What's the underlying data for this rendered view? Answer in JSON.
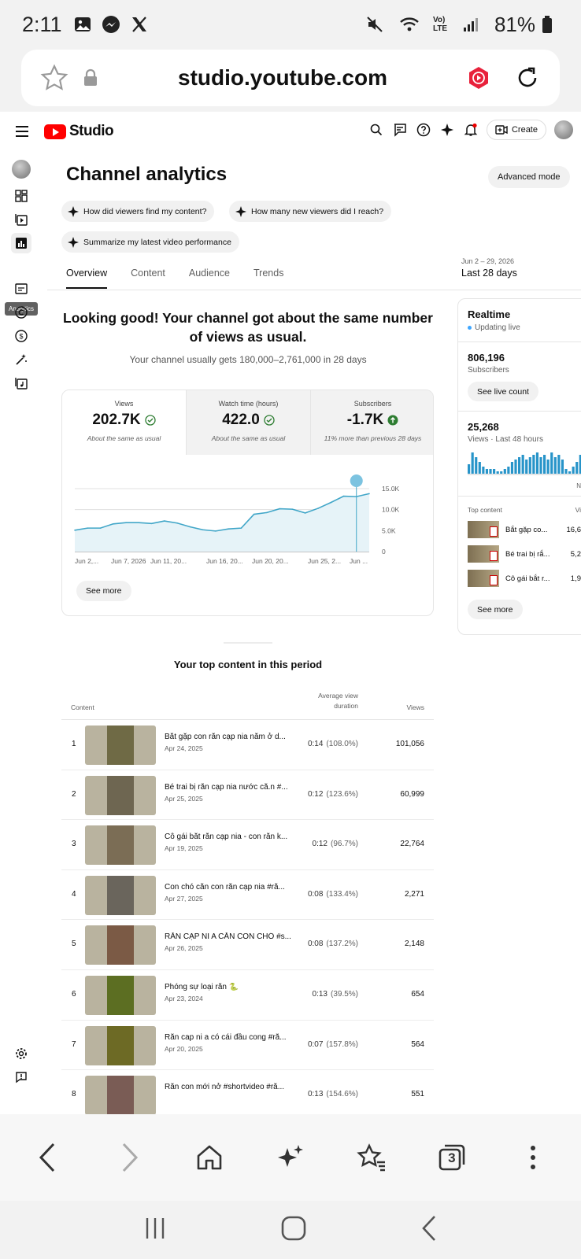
{
  "status_bar": {
    "time": "2:11",
    "battery": "81%",
    "network": "Vo) LTE"
  },
  "browser": {
    "url": "studio.youtube.com"
  },
  "header": {
    "logo_text": "Studio",
    "create_label": "Create"
  },
  "sidebar": {
    "tooltip": "Analytics"
  },
  "page": {
    "title": "Channel analytics",
    "advanced_mode_label": "Advanced mode"
  },
  "suggestions": [
    {
      "label": "How did viewers find my content?"
    },
    {
      "label": "How many new viewers did I reach?"
    },
    {
      "label": "Summarize my latest video performance"
    }
  ],
  "tabs": [
    {
      "label": "Overview",
      "active": true
    },
    {
      "label": "Content"
    },
    {
      "label": "Audience"
    },
    {
      "label": "Trends"
    }
  ],
  "date_range": {
    "dates": "Jun 2 – 29, 2026",
    "label": "Last 28 days"
  },
  "summary": {
    "headline": "Looking good! Your channel got about the same number of views as usual.",
    "subline": "Your channel usually gets 180,000–2,761,000 in 28 days"
  },
  "metrics": [
    {
      "label": "Views",
      "value": "202.7K",
      "note": "About the same as usual"
    },
    {
      "label": "Watch time (hours)",
      "value": "422.0",
      "note": "About the same as usual"
    },
    {
      "label": "Subscribers",
      "value": "-1.7K",
      "note": "11% more than previous 28 days"
    }
  ],
  "overview_see_more": "See more",
  "chart_data": {
    "type": "area",
    "series": [
      {
        "values": [
          5100,
          5600,
          5600,
          6600,
          6900,
          6900,
          6700,
          7300,
          6800,
          5900,
          5200,
          4900,
          5400,
          5600,
          8900,
          9300,
          10200,
          10100,
          9200,
          10300,
          11700,
          13200,
          13100,
          13800
        ]
      }
    ],
    "x_tick_labels": [
      "Jun 2,...",
      "Jun 7, 2026",
      "Jun 11, 20...",
      "Jun 16, 20...",
      "Jun 20, 20...",
      "Jun 25, 2...",
      "Jun ..."
    ],
    "y_tick_labels": [
      "15.0K",
      "10.0K",
      "5.0K",
      "0"
    ],
    "ylim": [
      0,
      15000
    ],
    "grid": true,
    "line_color": "#41a6c8",
    "fill_color": "#e6f3f8"
  },
  "realtime": {
    "title": "Realtime",
    "status": "Updating live",
    "subscribers_value": "806,196",
    "subscribers_label": "Subscribers",
    "live_count_label": "See live count",
    "views_value": "25,268",
    "views_label": "Views · Last 48 hours",
    "bars": [
      0.4,
      0.9,
      0.7,
      0.5,
      0.3,
      0.2,
      0.2,
      0.2,
      0.1,
      0.1,
      0.2,
      0.3,
      0.5,
      0.6,
      0.7,
      0.8,
      0.6,
      0.7,
      0.8,
      0.9,
      0.7,
      0.8,
      0.6,
      0.9,
      0.7,
      0.8,
      0.6,
      0.2,
      0.1,
      0.3,
      0.5,
      0.8,
      0.6,
      0.9,
      1.0
    ],
    "bars_color": "#2794c9",
    "axis_end_label": "N",
    "top_content_label": "Top content",
    "top_content_views_label": "Vi",
    "top_content": [
      {
        "title": "Bắt gặp co...",
        "views": "16,6"
      },
      {
        "title": "Bé trai bị rắ...",
        "views": "5,2"
      },
      {
        "title": "Cô gái bắt r...",
        "views": "1,9"
      }
    ],
    "see_more": "See more"
  },
  "top_content": {
    "title": "Your top content in this period",
    "headers": {
      "content": "Content",
      "avd_line1": "Average view",
      "avd_line2": "duration",
      "views": "Views"
    },
    "rows": [
      {
        "rank": "1",
        "title": "Bắt gặp con rắn cạp nia nằm ở d...",
        "date": "Apr 24, 2025",
        "avd": "0:14",
        "pct": "(108.0%)",
        "views": "101,056",
        "color": "#6f6a45"
      },
      {
        "rank": "2",
        "title": "Bé trai bị rắn cạp nia nước cắ.n #...",
        "date": "Apr 25, 2025",
        "avd": "0:12",
        "pct": "(123.6%)",
        "views": "60,999",
        "color": "#6e6651"
      },
      {
        "rank": "3",
        "title": "Cô gái bắt rắn cạp nia - con rắn k...",
        "date": "Apr 19, 2025",
        "avd": "0:12",
        "pct": "(96.7%)",
        "views": "22,764",
        "color": "#7b6d55"
      },
      {
        "rank": "4",
        "title": "Con chó cắn con rắn cạp nia #rắ...",
        "date": "Apr 27, 2025",
        "avd": "0:08",
        "pct": "(133.4%)",
        "views": "2,271",
        "color": "#6a655c"
      },
      {
        "rank": "5",
        "title": "RẮN CẠP NI A CẮN CON CHÓ #s...",
        "date": "Apr 26, 2025",
        "avd": "0:08",
        "pct": "(137.2%)",
        "views": "2,148",
        "color": "#7b5a45"
      },
      {
        "rank": "6",
        "title": "Phóng sự loại rắn 🐍",
        "date": "Apr 23, 2024",
        "avd": "0:13",
        "pct": "(39.5%)",
        "views": "654",
        "color": "#5c6e22"
      },
      {
        "rank": "7",
        "title": "Rắn cap ni a có cái đầu cong #rắ...",
        "date": "Apr 20, 2025",
        "avd": "0:07",
        "pct": "(157.8%)",
        "views": "564",
        "color": "#6d6a25"
      },
      {
        "rank": "8",
        "title": "Rắn con mới nở #shortvideo #rắ...",
        "date": "",
        "avd": "0:13",
        "pct": "(154.6%)",
        "views": "551",
        "color": "#7a5c55"
      }
    ]
  },
  "browser_nav": {
    "tabs_count": "3"
  }
}
